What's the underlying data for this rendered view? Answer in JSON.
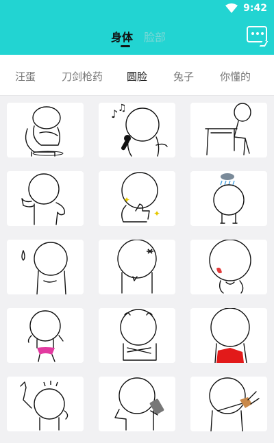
{
  "status_bar": {
    "time": "9:42",
    "icons": [
      "wifi-icon"
    ]
  },
  "header": {
    "main_tabs": [
      {
        "label": "身体",
        "active": true
      },
      {
        "label": "脸部",
        "active": false
      }
    ],
    "chat_icon": "chat-bubble-icon",
    "accent_color": "#22d4d2"
  },
  "sub_tabs": [
    {
      "label": "汪蛋",
      "active": false
    },
    {
      "label": "刀剑枪药",
      "active": false
    },
    {
      "label": "圆脸",
      "active": true
    },
    {
      "label": "兔子",
      "active": false
    },
    {
      "label": "你懂的",
      "active": false
    }
  ],
  "stickers": [
    {
      "name": "sitting-on-chair-hugging-knees"
    },
    {
      "name": "singing-with-microphone"
    },
    {
      "name": "sitting-at-desk"
    },
    {
      "name": "hands-on-hip-pointing"
    },
    {
      "name": "thumbs-up-sparkles"
    },
    {
      "name": "rain-cloud-sad"
    },
    {
      "name": "sweat-drop"
    },
    {
      "name": "angry-mark"
    },
    {
      "name": "blushing-shy"
    },
    {
      "name": "pink-underwear-dance"
    },
    {
      "name": "arms-crossed-back"
    },
    {
      "name": "red-cape-back"
    },
    {
      "name": "pointing-up-wave"
    },
    {
      "name": "holding-phone"
    },
    {
      "name": "slingshot"
    }
  ]
}
